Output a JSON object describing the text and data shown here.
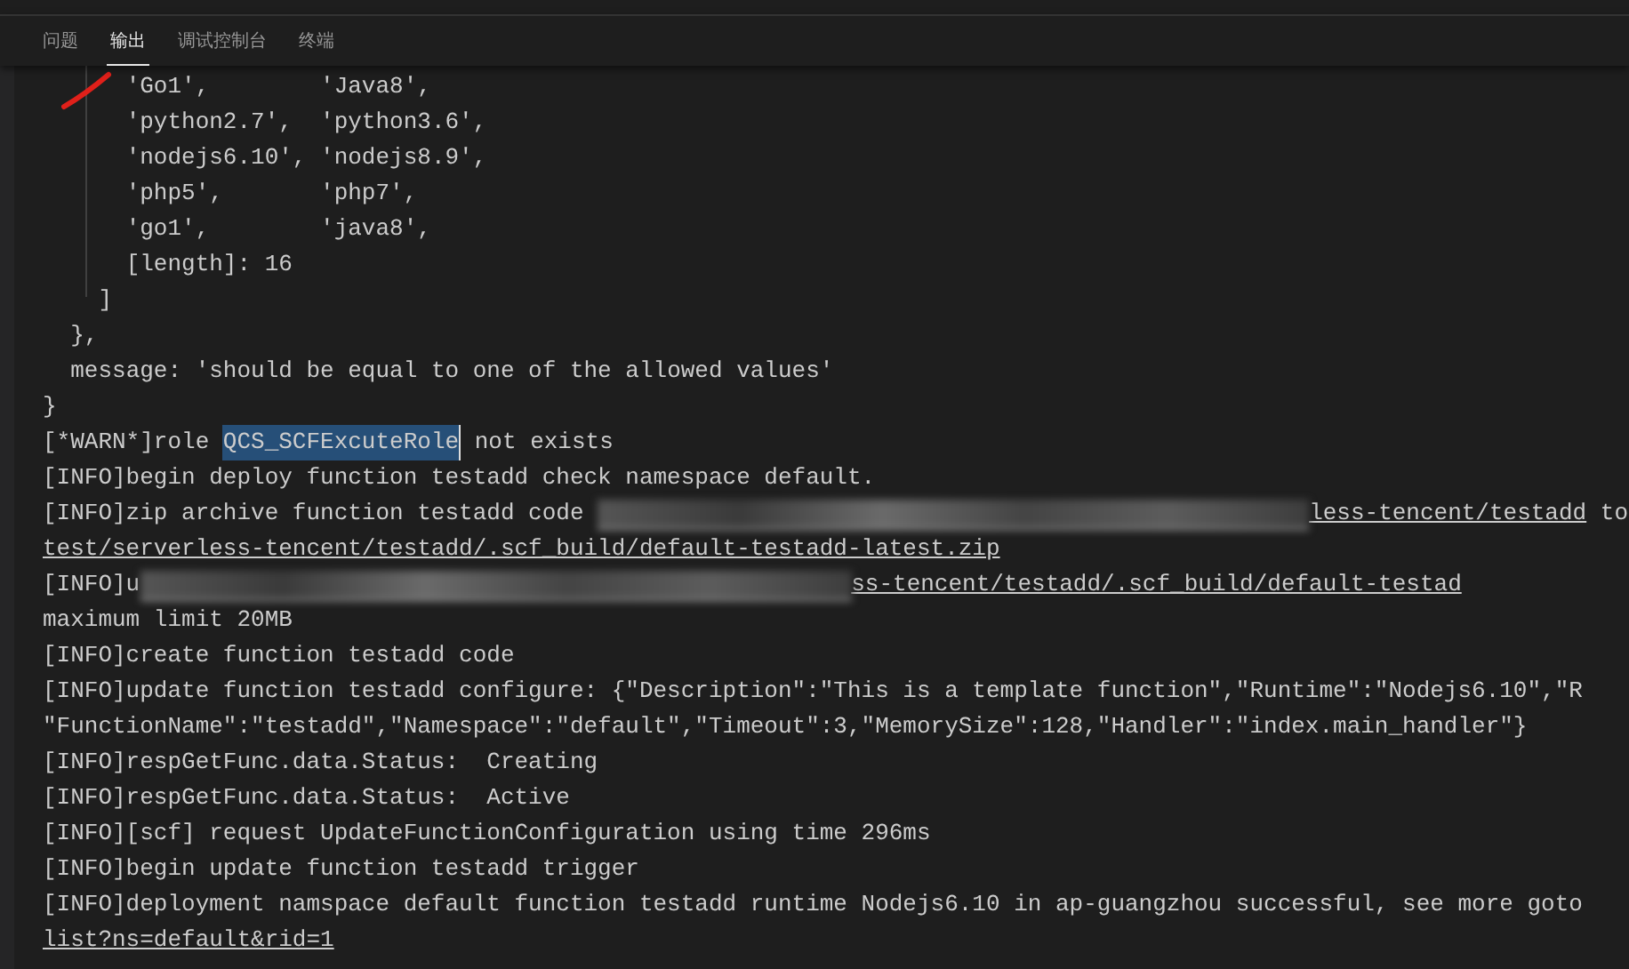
{
  "tabs": [
    {
      "label": "问题",
      "selected": false
    },
    {
      "label": "输出",
      "selected": true
    },
    {
      "label": "调试控制台",
      "selected": false
    },
    {
      "label": "终端",
      "selected": false
    }
  ],
  "output_lines": [
    [
      {
        "kind": "text",
        "text": "      'Go1',        'Java8',"
      }
    ],
    [
      {
        "kind": "text",
        "text": "      'python2.7',  'python3.6',"
      }
    ],
    [
      {
        "kind": "text",
        "text": "      'nodejs6.10', 'nodejs8.9',"
      }
    ],
    [
      {
        "kind": "text",
        "text": "      'php5',       'php7',"
      }
    ],
    [
      {
        "kind": "text",
        "text": "      'go1',        'java8',"
      }
    ],
    [
      {
        "kind": "text",
        "text": "      [length]: 16"
      }
    ],
    [
      {
        "kind": "text",
        "text": "    ]"
      }
    ],
    [
      {
        "kind": "text",
        "text": "  },"
      }
    ],
    [
      {
        "kind": "text",
        "text": "  message: 'should be equal to one of the allowed values'"
      }
    ],
    [
      {
        "kind": "text",
        "text": "}"
      }
    ],
    [
      {
        "kind": "text",
        "text": "[*WARN*]role "
      },
      {
        "kind": "highlight",
        "text": "QCS_SCFExcuteRole"
      },
      {
        "kind": "text",
        "text": " not exists"
      }
    ],
    [
      {
        "kind": "text",
        "text": "[INFO]begin deploy function testadd check namespace default."
      }
    ],
    [
      {
        "kind": "text",
        "text": "[INFO]zip archive function testadd code "
      },
      {
        "kind": "blur"
      },
      {
        "kind": "link",
        "text": "less-tencent/testadd"
      },
      {
        "kind": "text",
        "text": " to"
      }
    ],
    [
      {
        "kind": "link",
        "text": "test/serverless-tencent/testadd/.scf_build/default-testadd-latest.zip"
      }
    ],
    [
      {
        "kind": "text",
        "text": "[INFO]u"
      },
      {
        "kind": "blur"
      },
      {
        "kind": "link",
        "text": "ss-tencent/testadd/.scf_build/default-testad"
      }
    ],
    [
      {
        "kind": "text",
        "text": "maximum limit 20MB"
      }
    ],
    [
      {
        "kind": "text",
        "text": "[INFO]create function testadd code"
      }
    ],
    [
      {
        "kind": "text",
        "text": "[INFO]update function testadd configure: {\"Description\":\"This is a template function\",\"Runtime\":\"Nodejs6.10\",\"R"
      }
    ],
    [
      {
        "kind": "text",
        "text": "\"FunctionName\":\"testadd\",\"Namespace\":\"default\",\"Timeout\":3,\"MemorySize\":128,\"Handler\":\"index.main_handler\"}"
      }
    ],
    [
      {
        "kind": "text",
        "text": "[INFO]respGetFunc.data.Status:  Creating"
      }
    ],
    [
      {
        "kind": "text",
        "text": "[INFO]respGetFunc.data.Status:  Active"
      }
    ],
    [
      {
        "kind": "text",
        "text": "[INFO][scf] request UpdateFunctionConfiguration using time 296ms"
      }
    ],
    [
      {
        "kind": "text",
        "text": "[INFO]begin update function testadd trigger"
      }
    ],
    [
      {
        "kind": "text",
        "text": "[INFO]deployment namspace default function testadd runtime Nodejs6.10 in ap-guangzhou successful, see more goto"
      }
    ],
    [
      {
        "kind": "link",
        "text": "list?ns=default&rid=1"
      }
    ]
  ]
}
